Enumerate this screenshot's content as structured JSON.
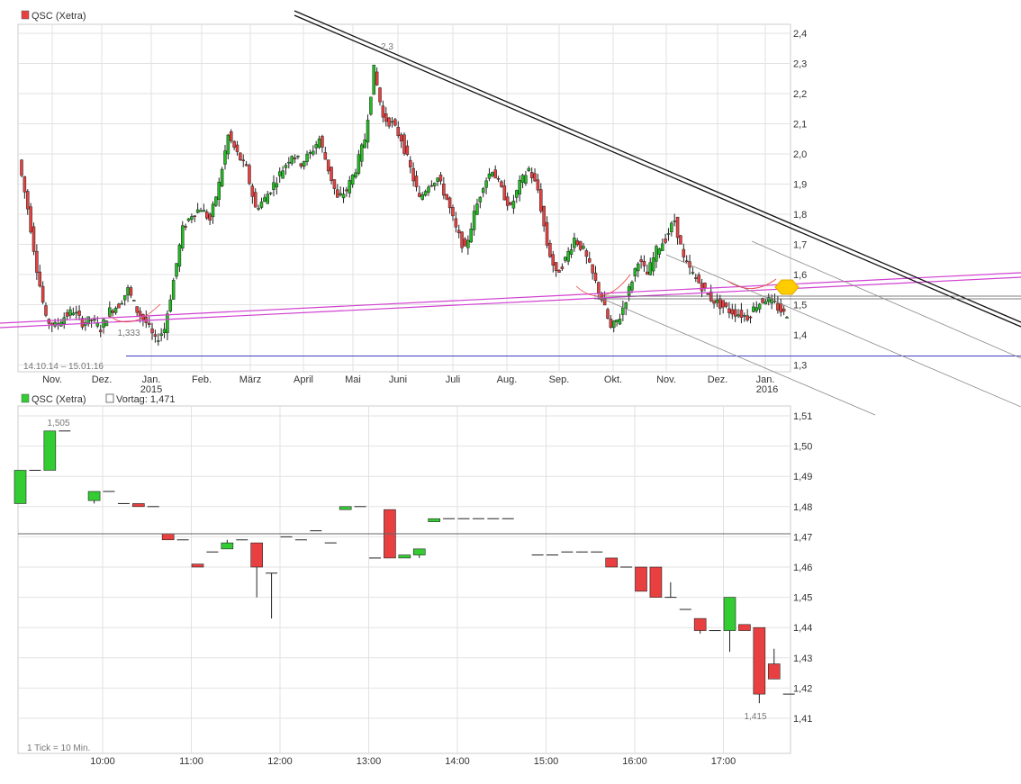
{
  "chart_data": [
    {
      "type": "candlestick",
      "legend": [
        {
          "label": "QSC (Xetra)",
          "color": "#e84040"
        }
      ],
      "date_range": "14.10.14 – 15.01.16",
      "x_tick_labels": [
        "Nov.",
        "Dez.",
        "Jan.",
        "Feb.",
        "März",
        "April",
        "Mai",
        "Juni",
        "Juli",
        "Aug.",
        "Sep.",
        "Okt.",
        "Nov.",
        "Dez.",
        "Jan."
      ],
      "x_year_labels": [
        "2015",
        "2016"
      ],
      "y_ticks": [
        "2,4",
        "2,3",
        "2,2",
        "2,1",
        "2,0",
        "1,9",
        "1,8",
        "1,7",
        "1,6",
        "1,5",
        "1,4",
        "1,3"
      ],
      "ylim": [
        1.22,
        2.42
      ],
      "annotations": [
        {
          "text": "2,3",
          "value": 2.3,
          "date": "Mai 2015"
        },
        {
          "text": "1,333",
          "value": 1.333,
          "date": "Dez. 2014"
        }
      ],
      "overlay_lines": [
        "black double downtrend line",
        "magenta double uptrend line",
        "blue horizontal support 1,333",
        "grey parallel channel lines"
      ],
      "colors": {
        "up": "#22bb22",
        "down": "#e84040",
        "trend": "#111111",
        "support": "#d040d0",
        "horizontal": "#4040c0",
        "marker": "#ffcc00"
      },
      "close_series": [
        1.98,
        1.82,
        1.62,
        1.45,
        1.43,
        1.46,
        1.48,
        1.44,
        1.45,
        1.42,
        1.48,
        1.5,
        1.55,
        1.48,
        1.44,
        1.38,
        1.42,
        1.58,
        1.75,
        1.8,
        1.82,
        1.78,
        1.9,
        2.06,
        2.0,
        1.95,
        1.82,
        1.85,
        1.9,
        1.95,
        2.0,
        1.97,
        2.0,
        2.05,
        1.95,
        1.85,
        1.88,
        1.95,
        2.05,
        2.28,
        2.12,
        2.1,
        2.05,
        1.95,
        1.85,
        1.9,
        1.92,
        1.85,
        1.75,
        1.68,
        1.8,
        1.9,
        1.95,
        1.88,
        1.82,
        1.9,
        1.95,
        1.88,
        1.7,
        1.6,
        1.65,
        1.72,
        1.68,
        1.6,
        1.52,
        1.42,
        1.46,
        1.55,
        1.65,
        1.6,
        1.68,
        1.72,
        1.78,
        1.65,
        1.6,
        1.56,
        1.52,
        1.5,
        1.48,
        1.47,
        1.46,
        1.5,
        1.52,
        1.5,
        1.47
      ]
    },
    {
      "type": "candlestick",
      "legend": [
        {
          "label": "QSC (Xetra)",
          "color": "#33cc33"
        },
        {
          "label": "Vortag: 1,471",
          "color": "#ffffff"
        }
      ],
      "interval_label": "1 Tick = 10 Min.",
      "x_tick_labels": [
        "10:00",
        "11:00",
        "12:00",
        "13:00",
        "14:00",
        "15:00",
        "16:00",
        "17:00"
      ],
      "y_ticks": [
        "1,51",
        "1,50",
        "1,49",
        "1,48",
        "1,47",
        "1,46",
        "1,45",
        "1,44",
        "1,43",
        "1,42",
        "1,41"
      ],
      "ylim": [
        1.4035,
        1.5135
      ],
      "reference_line": {
        "label": "Vortag",
        "value": 1.471
      },
      "annotations": [
        {
          "text": "1,505",
          "value": 1.505,
          "time": "09:30"
        },
        {
          "text": "1,415",
          "value": 1.415,
          "time": "17:20"
        }
      ],
      "colors": {
        "up": "#33cc33",
        "down": "#e84040",
        "flat": "#333333"
      },
      "ohlc": [
        {
          "time": "09:00",
          "o": 1.481,
          "h": 1.492,
          "l": 1.481,
          "c": 1.492
        },
        {
          "time": "09:10",
          "o": 1.492,
          "h": 1.492,
          "l": 1.492,
          "c": 1.492
        },
        {
          "time": "09:20",
          "o": 1.492,
          "h": 1.505,
          "l": 1.492,
          "c": 1.505
        },
        {
          "time": "09:30",
          "o": 1.505,
          "h": 1.505,
          "l": 1.505,
          "c": 1.505
        },
        {
          "time": "09:50",
          "o": 1.482,
          "h": 1.485,
          "l": 1.481,
          "c": 1.485
        },
        {
          "time": "10:00",
          "o": 1.485,
          "h": 1.485,
          "l": 1.485,
          "c": 1.485
        },
        {
          "time": "10:10",
          "o": 1.481,
          "h": 1.481,
          "l": 1.481,
          "c": 1.481
        },
        {
          "time": "10:20",
          "o": 1.481,
          "h": 1.481,
          "l": 1.48,
          "c": 1.48
        },
        {
          "time": "10:30",
          "o": 1.48,
          "h": 1.48,
          "l": 1.48,
          "c": 1.48
        },
        {
          "time": "10:40",
          "o": 1.471,
          "h": 1.471,
          "l": 1.469,
          "c": 1.469
        },
        {
          "time": "10:50",
          "o": 1.469,
          "h": 1.469,
          "l": 1.469,
          "c": 1.469
        },
        {
          "time": "11:00",
          "o": 1.461,
          "h": 1.461,
          "l": 1.46,
          "c": 1.46
        },
        {
          "time": "11:10",
          "o": 1.465,
          "h": 1.465,
          "l": 1.465,
          "c": 1.465
        },
        {
          "time": "11:20",
          "o": 1.466,
          "h": 1.469,
          "l": 1.466,
          "c": 1.468
        },
        {
          "time": "11:30",
          "o": 1.469,
          "h": 1.469,
          "l": 1.469,
          "c": 1.469
        },
        {
          "time": "11:40",
          "o": 1.468,
          "h": 1.468,
          "l": 1.45,
          "c": 1.46
        },
        {
          "time": "11:50",
          "o": 1.458,
          "h": 1.458,
          "l": 1.443,
          "c": 1.458
        },
        {
          "time": "12:00",
          "o": 1.47,
          "h": 1.47,
          "l": 1.47,
          "c": 1.47
        },
        {
          "time": "12:10",
          "o": 1.469,
          "h": 1.469,
          "l": 1.469,
          "c": 1.469
        },
        {
          "time": "12:20",
          "o": 1.472,
          "h": 1.472,
          "l": 1.472,
          "c": 1.472
        },
        {
          "time": "12:30",
          "o": 1.468,
          "h": 1.468,
          "l": 1.468,
          "c": 1.468
        },
        {
          "time": "12:40",
          "o": 1.479,
          "h": 1.48,
          "l": 1.479,
          "c": 1.48
        },
        {
          "time": "12:50",
          "o": 1.48,
          "h": 1.48,
          "l": 1.48,
          "c": 1.48
        },
        {
          "time": "13:00",
          "o": 1.463,
          "h": 1.463,
          "l": 1.463,
          "c": 1.463
        },
        {
          "time": "13:10",
          "o": 1.479,
          "h": 1.479,
          "l": 1.463,
          "c": 1.463
        },
        {
          "time": "13:20",
          "o": 1.463,
          "h": 1.464,
          "l": 1.463,
          "c": 1.464
        },
        {
          "time": "13:30",
          "o": 1.464,
          "h": 1.466,
          "l": 1.463,
          "c": 1.466
        },
        {
          "time": "13:40",
          "o": 1.475,
          "h": 1.476,
          "l": 1.475,
          "c": 1.476
        },
        {
          "time": "13:50",
          "o": 1.476,
          "h": 1.476,
          "l": 1.476,
          "c": 1.476
        },
        {
          "time": "14:00",
          "o": 1.476,
          "h": 1.476,
          "l": 1.476,
          "c": 1.476
        },
        {
          "time": "14:10",
          "o": 1.476,
          "h": 1.476,
          "l": 1.476,
          "c": 1.476
        },
        {
          "time": "14:20",
          "o": 1.476,
          "h": 1.476,
          "l": 1.476,
          "c": 1.476
        },
        {
          "time": "14:30",
          "o": 1.476,
          "h": 1.476,
          "l": 1.476,
          "c": 1.476
        },
        {
          "time": "14:50",
          "o": 1.464,
          "h": 1.464,
          "l": 1.464,
          "c": 1.464
        },
        {
          "time": "15:00",
          "o": 1.464,
          "h": 1.464,
          "l": 1.464,
          "c": 1.464
        },
        {
          "time": "15:10",
          "o": 1.465,
          "h": 1.465,
          "l": 1.465,
          "c": 1.465
        },
        {
          "time": "15:20",
          "o": 1.465,
          "h": 1.465,
          "l": 1.465,
          "c": 1.465
        },
        {
          "time": "15:30",
          "o": 1.465,
          "h": 1.465,
          "l": 1.465,
          "c": 1.465
        },
        {
          "time": "15:40",
          "o": 1.463,
          "h": 1.463,
          "l": 1.46,
          "c": 1.46
        },
        {
          "time": "15:50",
          "o": 1.46,
          "h": 1.46,
          "l": 1.46,
          "c": 1.46
        },
        {
          "time": "16:00",
          "o": 1.46,
          "h": 1.46,
          "l": 1.452,
          "c": 1.452
        },
        {
          "time": "16:10",
          "o": 1.46,
          "h": 1.46,
          "l": 1.45,
          "c": 1.45
        },
        {
          "time": "16:20",
          "o": 1.45,
          "h": 1.455,
          "l": 1.45,
          "c": 1.45
        },
        {
          "time": "16:30",
          "o": 1.446,
          "h": 1.446,
          "l": 1.446,
          "c": 1.446
        },
        {
          "time": "16:40",
          "o": 1.443,
          "h": 1.443,
          "l": 1.438,
          "c": 1.439
        },
        {
          "time": "16:50",
          "o": 1.439,
          "h": 1.439,
          "l": 1.439,
          "c": 1.439
        },
        {
          "time": "17:00",
          "o": 1.439,
          "h": 1.45,
          "l": 1.432,
          "c": 1.45
        },
        {
          "time": "17:10",
          "o": 1.441,
          "h": 1.441,
          "l": 1.439,
          "c": 1.439
        },
        {
          "time": "17:20",
          "o": 1.44,
          "h": 1.44,
          "l": 1.415,
          "c": 1.418
        },
        {
          "time": "17:30",
          "o": 1.428,
          "h": 1.433,
          "l": 1.423,
          "c": 1.423
        },
        {
          "time": "17:40",
          "o": 1.418,
          "h": 1.418,
          "l": 1.418,
          "c": 1.418
        }
      ]
    }
  ]
}
